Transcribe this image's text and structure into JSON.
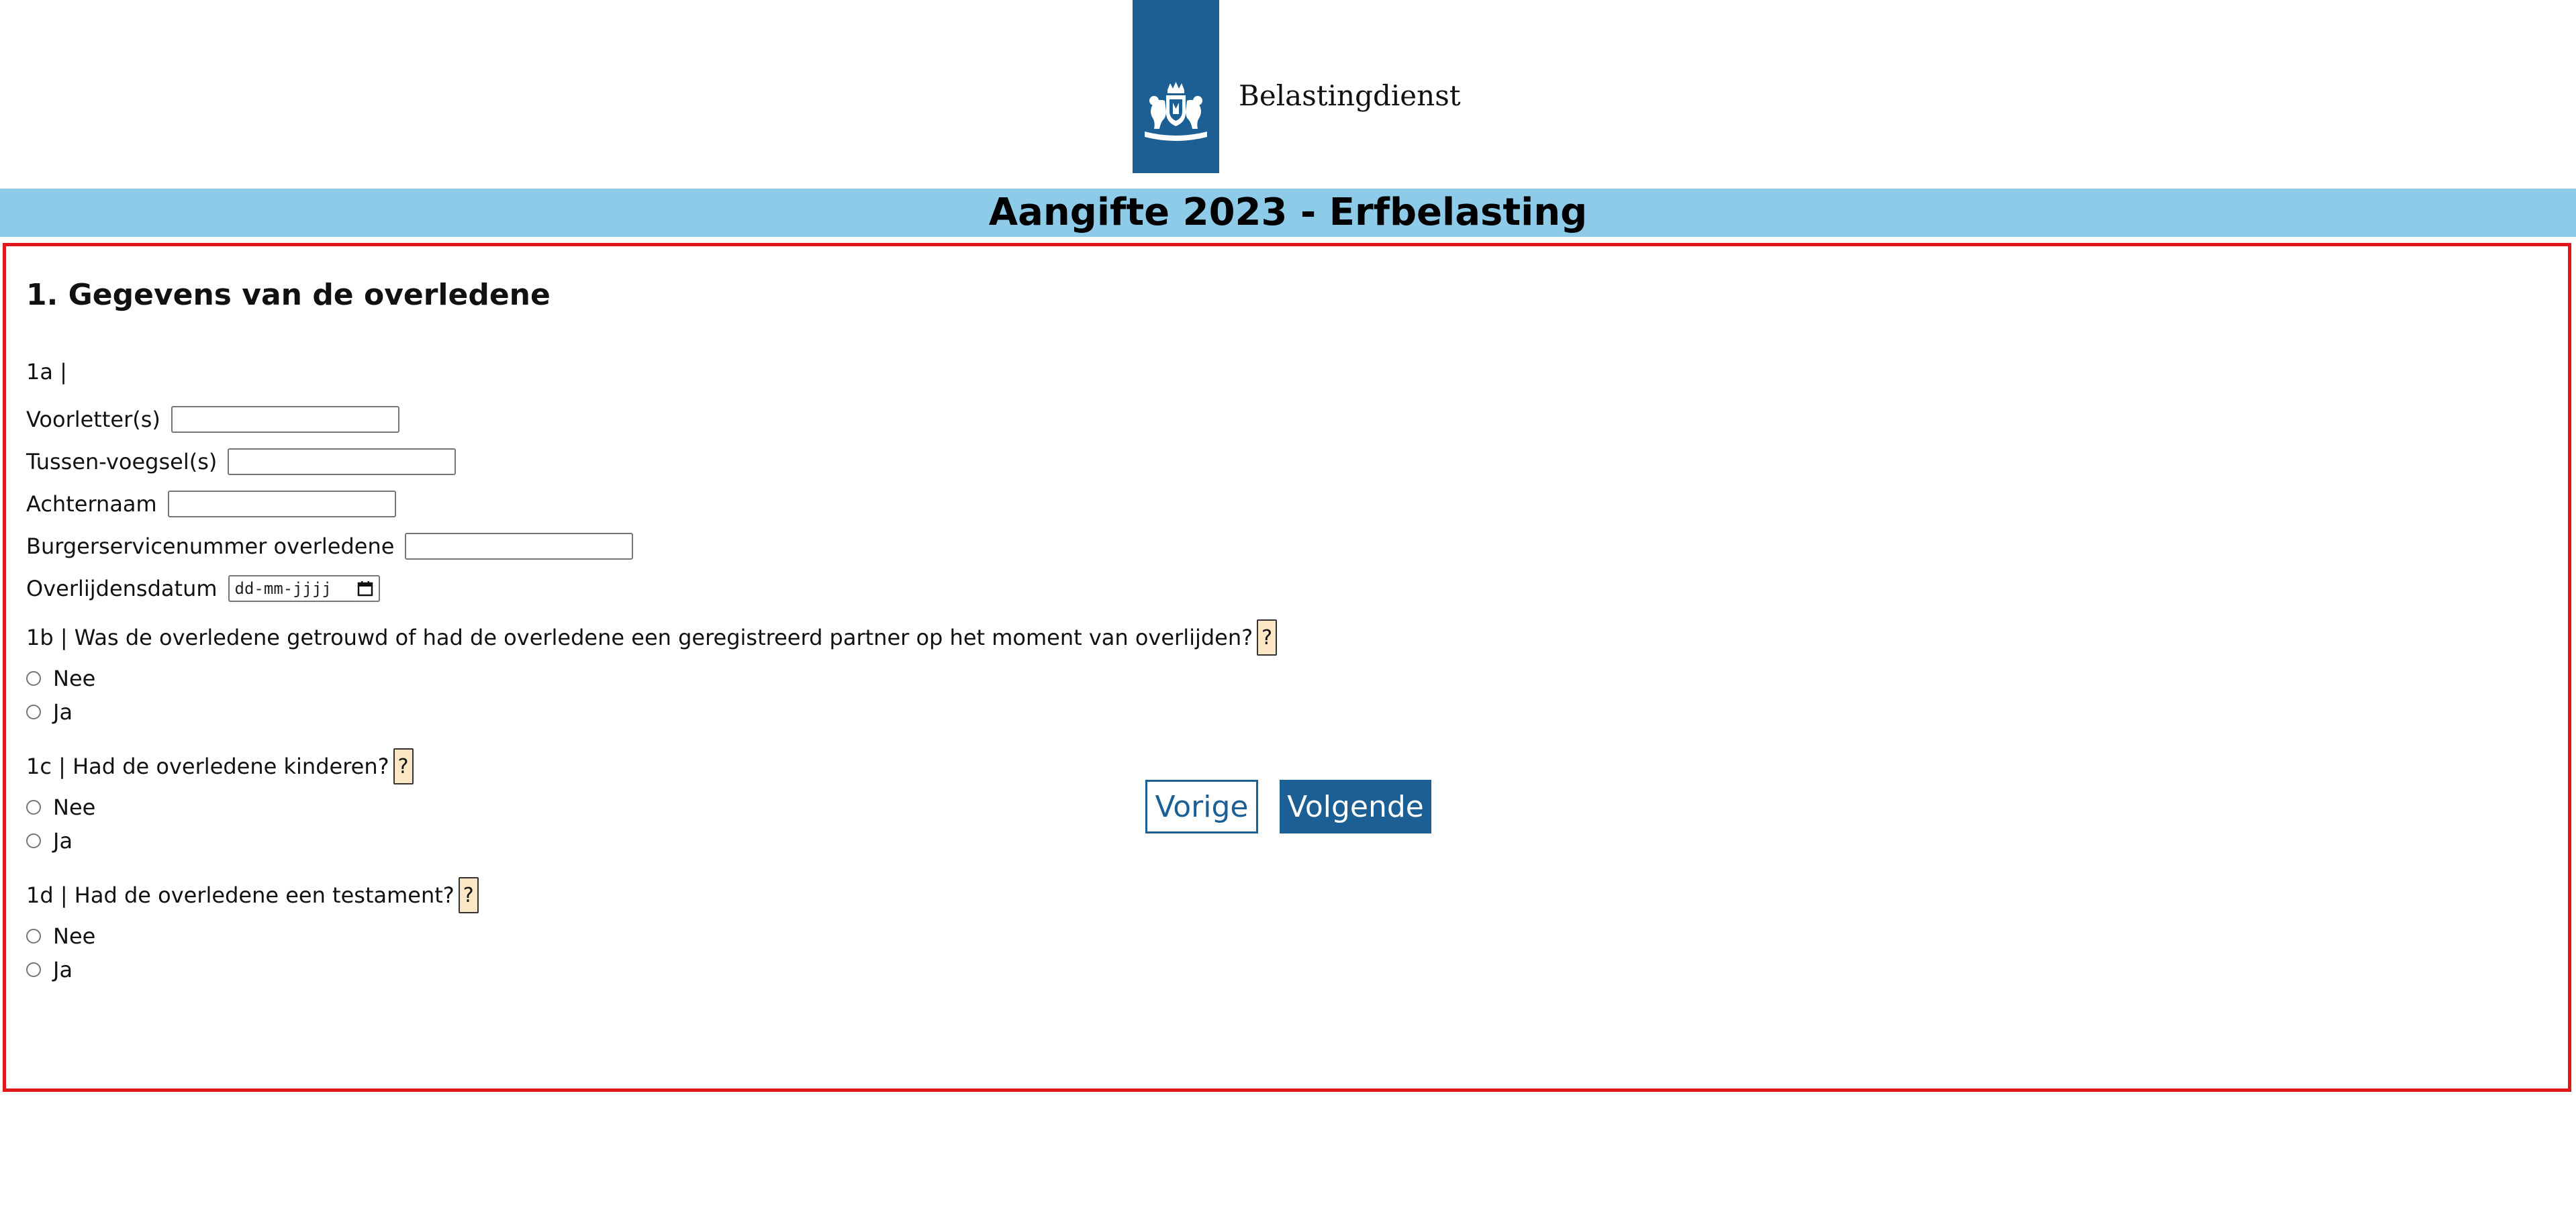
{
  "header": {
    "brand_name": "Belastingdienst",
    "logo_icon": "coat-of-arms-icon",
    "brand_color": "#1b5f94",
    "title": "Aangifte 2023 - Erfbelasting",
    "title_band_color": "#8ecbe8"
  },
  "form": {
    "border_color": "#e0181b",
    "section_heading": "1. Gegevens van de overledene",
    "q1a": {
      "label": "1a |",
      "fields": {
        "initials": {
          "label": "Voorletter(s)",
          "value": ""
        },
        "prefix": {
          "label": "Tussen-voegsel(s)",
          "value": ""
        },
        "surname": {
          "label": "Achternaam",
          "value": ""
        },
        "bsn": {
          "label": "Burgerservicenummer overledene",
          "value": ""
        },
        "date_of_death": {
          "label": "Overlijdensdatum",
          "placeholder": "dd-mm-jjjj"
        }
      }
    },
    "q1b": {
      "text": "1b | Was de overledene getrouwd of had de overledene een geregistreerd partner op het moment van overlijden?",
      "help": "?",
      "options": [
        "Nee",
        "Ja"
      ]
    },
    "q1c": {
      "text": "1c | Had de overledene kinderen?",
      "help": "?",
      "options": [
        "Nee",
        "Ja"
      ]
    },
    "q1d": {
      "text": "1d | Had de overledene een testament?",
      "help": "?",
      "options": [
        "Nee",
        "Ja"
      ]
    }
  },
  "nav": {
    "prev_label": "Vorige",
    "next_label": "Volgende"
  }
}
